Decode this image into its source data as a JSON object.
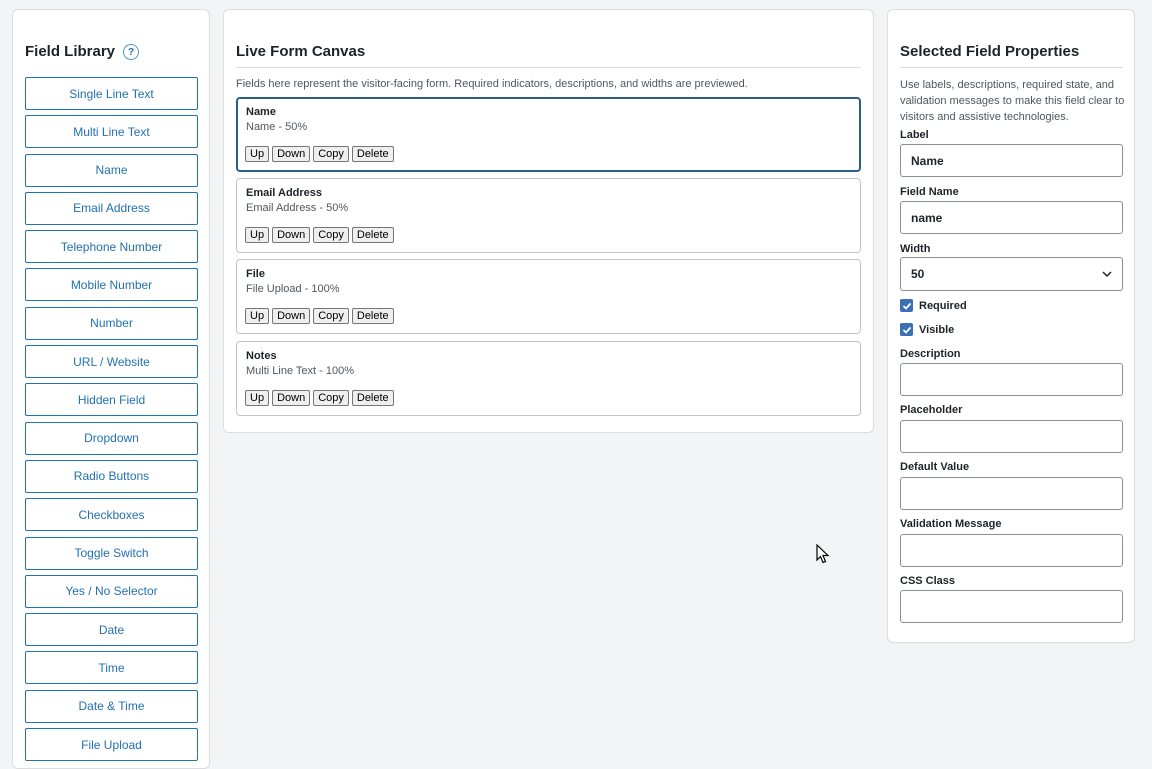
{
  "library": {
    "title": "Field Library",
    "help_glyph": "?",
    "items": [
      "Single Line Text",
      "Multi Line Text",
      "Name",
      "Email Address",
      "Telephone Number",
      "Mobile Number",
      "Number",
      "URL / Website",
      "Hidden Field",
      "Dropdown",
      "Radio Buttons",
      "Checkboxes",
      "Toggle Switch",
      "Yes / No Selector",
      "Date",
      "Time",
      "Date & Time",
      "File Upload"
    ]
  },
  "canvas": {
    "title": "Live Form Canvas",
    "description": "Fields here represent the visitor-facing form. Required indicators, descriptions, and widths are previewed.",
    "action_labels": {
      "up": "Up",
      "down": "Down",
      "copy": "Copy",
      "delete": "Delete"
    },
    "fields": [
      {
        "title": "Name",
        "subtitle": "Name - 50%",
        "selected": true
      },
      {
        "title": "Email Address",
        "subtitle": "Email Address - 50%",
        "selected": false
      },
      {
        "title": "File",
        "subtitle": "File Upload - 100%",
        "selected": false
      },
      {
        "title": "Notes",
        "subtitle": "Multi Line Text - 100%",
        "selected": false
      }
    ]
  },
  "props": {
    "title": "Selected Field Properties",
    "description": "Use labels, descriptions, required state, and validation messages to make this field clear to visitors and assistive technologies.",
    "label": {
      "label": "Label",
      "value": "Name"
    },
    "field_name": {
      "label": "Field Name",
      "value": "name"
    },
    "width": {
      "label": "Width",
      "value": "50"
    },
    "required": {
      "label": "Required",
      "checked": true
    },
    "visible": {
      "label": "Visible",
      "checked": true
    },
    "description_field": {
      "label": "Description",
      "value": ""
    },
    "placeholder": {
      "label": "Placeholder",
      "value": ""
    },
    "default_value": {
      "label": "Default Value",
      "value": ""
    },
    "validation_message": {
      "label": "Validation Message",
      "value": ""
    },
    "css_class": {
      "label": "CSS Class",
      "value": ""
    }
  },
  "colors": {
    "accent": "#2271b1",
    "selected_border": "#2c5f88",
    "checkbox": "#3b6fb6"
  }
}
